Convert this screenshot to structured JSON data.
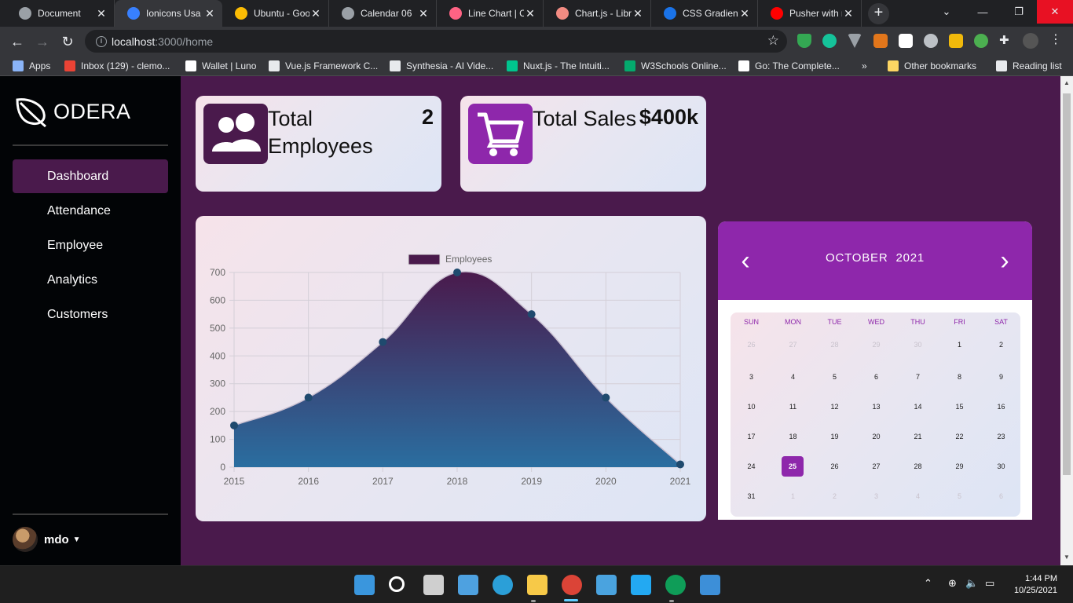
{
  "browser": {
    "tabs": [
      {
        "label": "Document",
        "icon": "globe-icon",
        "color": "#9aa0a6"
      },
      {
        "label": "Ionicons Usa",
        "icon": "ionicons-icon",
        "color": "#3880ff"
      },
      {
        "label": "Ubuntu - Goo",
        "icon": "google-fonts-icon",
        "color": "#fbbc04"
      },
      {
        "label": "Calendar 06",
        "icon": "globe-icon",
        "color": "#9aa0a6"
      },
      {
        "label": "Line Chart | C",
        "icon": "chartjs-icon",
        "color": "#ff6384"
      },
      {
        "label": "Chart.js - Libr",
        "icon": "code-icon",
        "color": "#f28b82"
      },
      {
        "label": "CSS Gradient",
        "icon": "cssgradient-icon",
        "color": "#1a73e8"
      },
      {
        "label": "Pusher with n",
        "icon": "youtube-icon",
        "color": "#ff0000"
      }
    ],
    "url_host": "localhost",
    "url_path": ":3000/home",
    "bookmarks": [
      {
        "label": "Apps",
        "icon": "apps-grid-icon",
        "color": "#8ab4f8"
      },
      {
        "label": "Inbox (129) - clemo...",
        "icon": "gmail-icon",
        "color": "#ea4335"
      },
      {
        "label": "Wallet | Luno",
        "icon": "luno-icon",
        "color": "#ffffff"
      },
      {
        "label": "Vue.js Framework C...",
        "icon": "vue-icon",
        "color": "#e8eaed"
      },
      {
        "label": "Synthesia - AI Vide...",
        "icon": "synthesia-icon",
        "color": "#e8eaed"
      },
      {
        "label": "Nuxt.js - The Intuiti...",
        "icon": "nuxt-icon",
        "color": "#00c58e"
      },
      {
        "label": "W3Schools Online...",
        "icon": "w3schools-icon",
        "color": "#04aa6d"
      },
      {
        "label": "Go: The Complete...",
        "icon": "udemy-icon",
        "color": "#ffffff"
      },
      {
        "label": "Other bookmarks",
        "icon": "folder-icon",
        "color": "#fdd663"
      },
      {
        "label": "Reading list",
        "icon": "reading-list-icon",
        "color": "#e8eaed"
      }
    ],
    "more_bookmarks": "»"
  },
  "sidebar": {
    "brand": "ODERA",
    "nav": [
      {
        "label": "Dashboard",
        "active": true
      },
      {
        "label": "Attendance",
        "active": false
      },
      {
        "label": "Employee",
        "active": false
      },
      {
        "label": "Analytics",
        "active": false
      },
      {
        "label": "Customers",
        "active": false
      }
    ],
    "user": "mdo"
  },
  "stats": [
    {
      "title": "Total Employees",
      "value": "2",
      "icon": "people-icon",
      "icon_bg": "#4a1a4c"
    },
    {
      "title": "Total Sales",
      "value": "$400k",
      "icon": "cart-icon",
      "icon_bg": "#8e27ab"
    }
  ],
  "chart_data": {
    "type": "area",
    "x": [
      "2015",
      "2016",
      "2017",
      "2018",
      "2019",
      "2020",
      "2021"
    ],
    "series": [
      {
        "name": "Employees",
        "values": [
          150,
          250,
          450,
          700,
          550,
          250,
          10
        ]
      }
    ],
    "yticks": [
      "0",
      "100",
      "200",
      "300",
      "400",
      "500",
      "600",
      "700"
    ],
    "ylim": [
      0,
      700
    ],
    "grid": true,
    "legend": "top",
    "colors": {
      "top": "#4a1a4c",
      "bottom": "#2a6ea0",
      "point": "#1f4a6e"
    }
  },
  "calendar": {
    "month": "OCTOBER",
    "year": "2021",
    "prev": "‹",
    "next": "›",
    "weekdays": [
      "SUN",
      "MON",
      "TUE",
      "WED",
      "THU",
      "FRI",
      "SAT"
    ],
    "weeks": [
      [
        {
          "d": "26",
          "m": true
        },
        {
          "d": "27",
          "m": true
        },
        {
          "d": "28",
          "m": true
        },
        {
          "d": "29",
          "m": true
        },
        {
          "d": "30",
          "m": true
        },
        {
          "d": "1"
        },
        {
          "d": "2"
        }
      ],
      [
        {
          "d": "3"
        },
        {
          "d": "4"
        },
        {
          "d": "5"
        },
        {
          "d": "6"
        },
        {
          "d": "7"
        },
        {
          "d": "8"
        },
        {
          "d": "9"
        }
      ],
      [
        {
          "d": "10"
        },
        {
          "d": "11"
        },
        {
          "d": "12"
        },
        {
          "d": "13"
        },
        {
          "d": "14"
        },
        {
          "d": "15"
        },
        {
          "d": "16"
        }
      ],
      [
        {
          "d": "17"
        },
        {
          "d": "18"
        },
        {
          "d": "19"
        },
        {
          "d": "20"
        },
        {
          "d": "21"
        },
        {
          "d": "22"
        },
        {
          "d": "23"
        }
      ],
      [
        {
          "d": "24"
        },
        {
          "d": "25",
          "today": true
        },
        {
          "d": "26"
        },
        {
          "d": "27"
        },
        {
          "d": "28"
        },
        {
          "d": "29"
        },
        {
          "d": "30"
        }
      ],
      [
        {
          "d": "31"
        },
        {
          "d": "1",
          "m": true
        },
        {
          "d": "2",
          "m": true
        },
        {
          "d": "3",
          "m": true
        },
        {
          "d": "4",
          "m": true
        },
        {
          "d": "5",
          "m": true
        },
        {
          "d": "6",
          "m": true
        }
      ]
    ]
  },
  "taskbar": {
    "time": "1:44 PM",
    "date": "10/25/2021",
    "apps": [
      {
        "name": "windows-start-icon",
        "color": "#3a96dd"
      },
      {
        "name": "search-icon",
        "color": "#ffffff"
      },
      {
        "name": "task-view-icon",
        "color": "#cfcfcf"
      },
      {
        "name": "widgets-icon",
        "color": "#4ea1e0"
      },
      {
        "name": "edge-icon",
        "color": "#2b9fd8"
      },
      {
        "name": "file-explorer-icon",
        "color": "#f7c948"
      },
      {
        "name": "chrome-icon",
        "color": "#db4437"
      },
      {
        "name": "microsoft-store-icon",
        "color": "#4aa3df"
      },
      {
        "name": "vscode-icon",
        "color": "#23a9f2"
      },
      {
        "name": "chrome-profile-icon",
        "color": "#0f9d58"
      },
      {
        "name": "photos-icon",
        "color": "#3d8fd8"
      }
    ]
  }
}
